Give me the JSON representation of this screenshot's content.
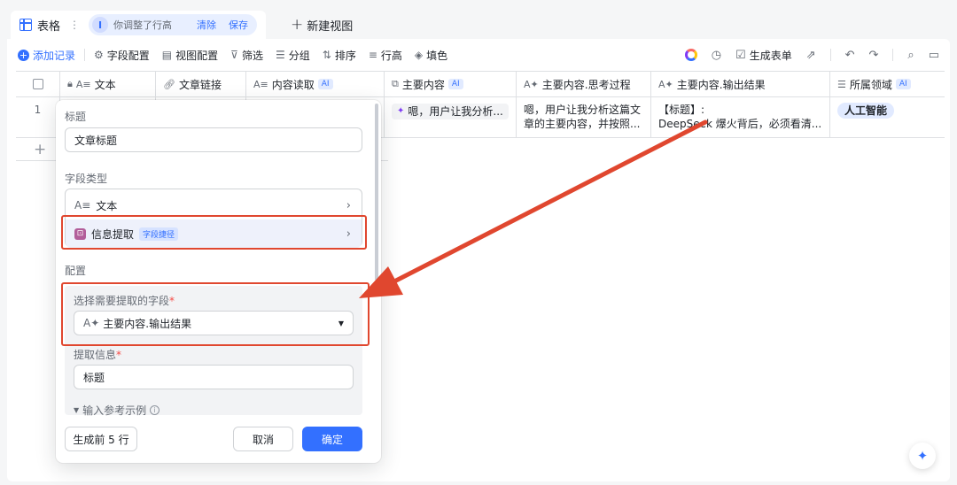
{
  "viewbar": {
    "tab_label": "表格",
    "notice_text": "你调整了行高",
    "clear_label": "清除",
    "save_label": "保存",
    "new_view_label": "新建视图"
  },
  "toolbar": {
    "add_record": "添加记录",
    "field_config": "字段配置",
    "view_config": "视图配置",
    "filter": "筛选",
    "group": "分组",
    "sort": "排序",
    "row_height": "行高",
    "fill": "填色",
    "generate_form": "生成表单"
  },
  "table": {
    "columns": [
      {
        "label": "文本",
        "icon": "text-icon",
        "ai": false,
        "primary": true
      },
      {
        "label": "文章链接",
        "icon": "link-icon",
        "ai": false
      },
      {
        "label": "内容读取",
        "icon": "text-icon",
        "ai": true
      },
      {
        "label": "主要内容",
        "icon": "ai-field-icon",
        "ai": true
      },
      {
        "label": "主要内容.思考过程",
        "icon": "ai-text-icon",
        "ai": false
      },
      {
        "label": "主要内容.输出结果",
        "icon": "ai-text-icon",
        "ai": false
      },
      {
        "label": "所属领域",
        "icon": "list-icon",
        "ai": true
      }
    ],
    "ai_badge": "AI",
    "rows": [
      {
        "index": "1",
        "main_content": "嗯，用户让我分析...",
        "thinking_line1": "嗯，用户让我分析这篇文",
        "thinking_line2": "章的主要内容，并按照...",
        "output_line1": "【标题】:",
        "output_line2": "DeepSeek 爆火背后，必须看清...",
        "domain_tag": "人工智能"
      }
    ]
  },
  "popup": {
    "title_label": "标题",
    "title_value": "文章标题",
    "field_type_label": "字段类型",
    "field_type_text": "文本",
    "extension_name": "信息提取",
    "extension_badge": "字段捷径",
    "config_label": "配置",
    "select_field_label": "选择需要提取的字段",
    "select_field_value": "主要内容.输出结果",
    "extract_info_label": "提取信息",
    "extract_info_value": "标题",
    "example_toggle": "输入参考示例",
    "generate_first": "生成前 5 行",
    "cancel": "取消",
    "confirm": "确定"
  },
  "colors": {
    "accent": "#3370ff",
    "annotation": "#e0472f"
  }
}
